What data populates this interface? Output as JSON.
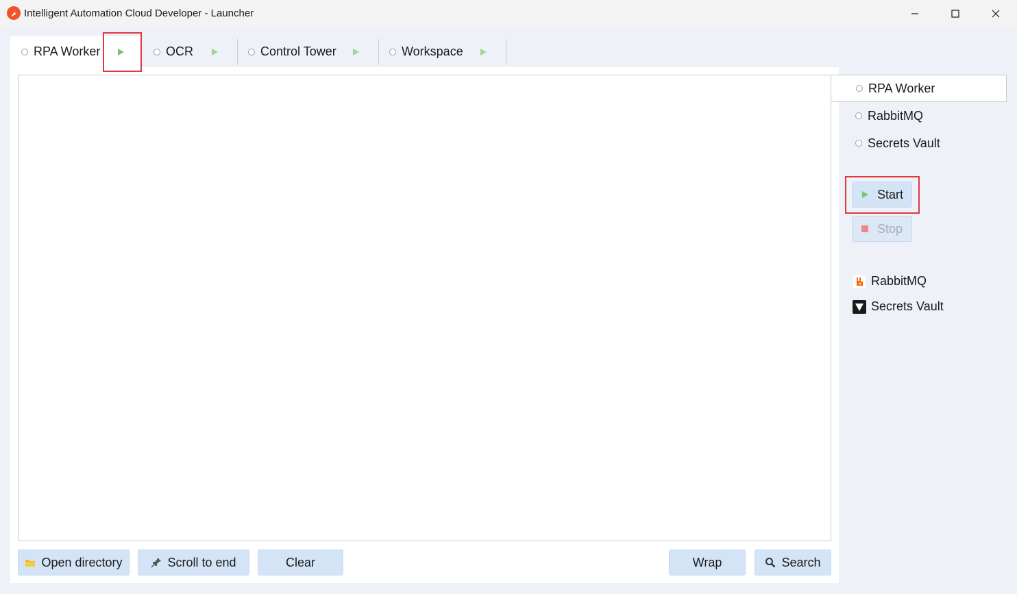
{
  "window": {
    "title": "Intelligent Automation Cloud Developer - Launcher",
    "controls": {
      "minimize": "minimize",
      "maximize": "maximize",
      "close": "close"
    }
  },
  "tabs": [
    {
      "label": "RPA Worker",
      "active": true
    },
    {
      "label": "OCR",
      "active": false
    },
    {
      "label": "Control Tower",
      "active": false
    },
    {
      "label": "Workspace",
      "active": false
    }
  ],
  "toolbar": {
    "open_directory": "Open directory",
    "scroll_to_end": "Scroll to end",
    "clear": "Clear",
    "wrap": "Wrap",
    "search": "Search"
  },
  "side_panel": {
    "services": [
      {
        "label": "RPA Worker",
        "selected": true
      },
      {
        "label": "RabbitMQ",
        "selected": false
      },
      {
        "label": "Secrets Vault",
        "selected": false
      }
    ],
    "start_label": "Start",
    "stop_label": "Stop",
    "links": [
      {
        "label": "RabbitMQ",
        "icon": "rabbitmq-icon"
      },
      {
        "label": "Secrets Vault",
        "icon": "vault-icon"
      }
    ]
  },
  "colors": {
    "accent_button": "#d4e4f7",
    "play_green": "#7cc36a",
    "stop_red": "#e88a8a",
    "highlight_red": "#e0393e",
    "app_logo": "#f0542a"
  }
}
